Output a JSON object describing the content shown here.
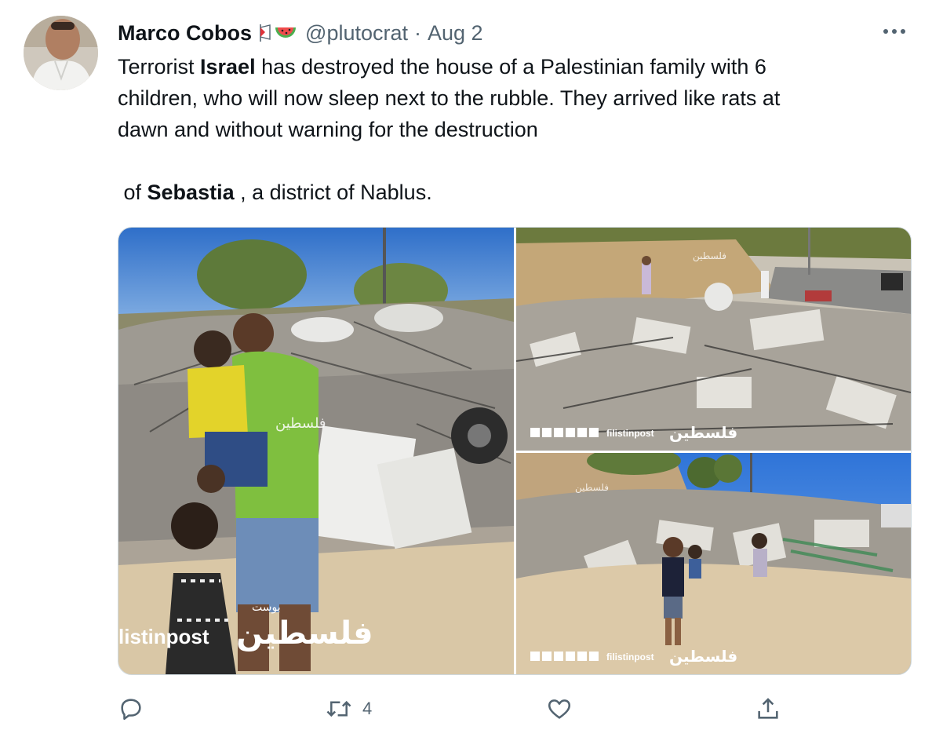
{
  "tweet": {
    "display_name": "Marco Cobos",
    "handle": "@plutocrat",
    "separator": "·",
    "date": "Aug 2",
    "text_line1_pre": "Terrorist ",
    "text_line1_bold": "Israel",
    "text_line1_post": " has destroyed the house of a Palestinian family with 6",
    "text_line2": "children, who will now sleep next to the rubble. They arrived like rats at",
    "text_line3": "dawn and without warning for the destruction",
    "text_line4_pre": " of ",
    "text_line4_bold": "Sebastia",
    "text_line4_post": " , a district of Nablus."
  },
  "header_icons": [
    "palestinian-flag-icon",
    "watermelon-icon"
  ],
  "media": {
    "watermark_brand": "filistinpost",
    "watermark_brand_large": "listinpost",
    "watermark_arabic": "فلسطين",
    "watermark_arabic_small": "بوست"
  },
  "actions": {
    "reply_count": "",
    "retweet_count": "4",
    "like_count": "",
    "icons": [
      "reply-icon",
      "retweet-icon",
      "like-icon",
      "share-icon"
    ]
  },
  "colors": {
    "text": "#0f1419",
    "secondary": "#536471",
    "border": "#cfd9de"
  }
}
